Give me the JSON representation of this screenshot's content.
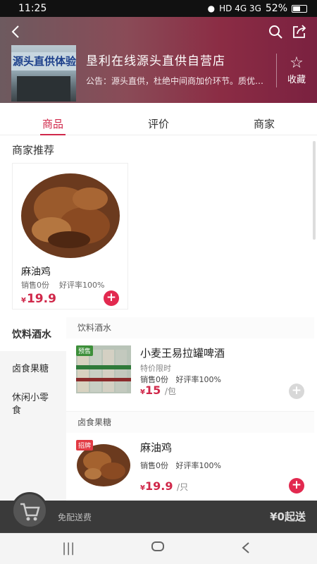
{
  "status": {
    "time": "11:25",
    "signal": "HD 4G 3G",
    "battery": "52%"
  },
  "shop": {
    "title": "垦利在线源头直供自营店",
    "notice": "公告：源头直供，杜绝中间商加价环节。质优价廉",
    "sign_text": "源头直供体验",
    "favorite_label": "收藏"
  },
  "tabs": [
    {
      "label": "商品",
      "active": true
    },
    {
      "label": "评价",
      "active": false
    },
    {
      "label": "商家",
      "active": false
    }
  ],
  "recommend": {
    "title": "商家推荐",
    "item": {
      "name": "麻油鸡",
      "sales": "销售0份",
      "rating": "好评率100%",
      "currency": "¥",
      "price": "19.9"
    }
  },
  "categories": [
    {
      "label": "饮料酒水",
      "active": true
    },
    {
      "label": "卤食果糖",
      "active": false
    },
    {
      "label": "休闲小零食",
      "active": false
    }
  ],
  "sections": [
    {
      "title": "饮料酒水",
      "product": {
        "tag": "预售",
        "name": "小麦王易拉罐啤酒",
        "sub": "特价限时",
        "sales": "销售0份",
        "rating": "好评率100%",
        "currency": "¥",
        "price": "15",
        "unit": "/包",
        "add_enabled": false
      }
    },
    {
      "title": "卤食果糖",
      "product": {
        "tag": "招牌",
        "name": "麻油鸡",
        "sub": "",
        "sales": "销售0份",
        "rating": "好评率100%",
        "currency": "¥",
        "price": "19.9",
        "unit": "/只",
        "add_enabled": true
      }
    }
  ],
  "cart": {
    "shipping": "免配送费",
    "minimum": "¥0起送"
  },
  "icons": {
    "back": "back-arrow-icon",
    "search": "search-icon",
    "share": "share-icon",
    "favorite": "star-icon",
    "cart": "cart-icon",
    "add": "plus-icon"
  },
  "colors": {
    "accent": "#d0284a",
    "add_button": "#e2294f",
    "add_disabled": "#d8d8d8"
  }
}
